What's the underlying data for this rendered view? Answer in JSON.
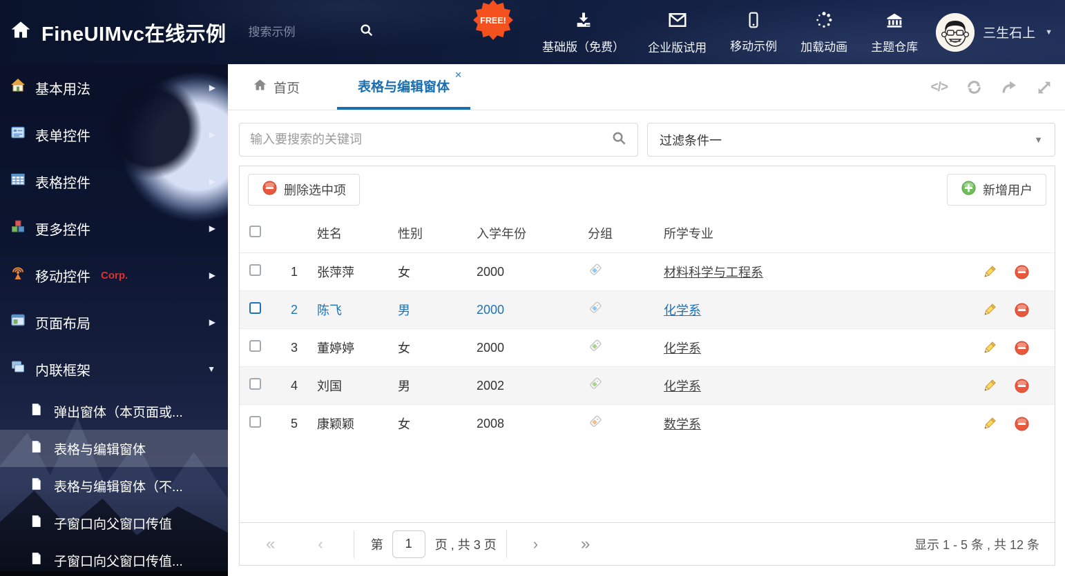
{
  "glyphs": {
    "caret_right": "▶",
    "caret_down": "▼",
    "close": "✕",
    "code": "</>",
    "first": "«",
    "prev": "‹",
    "next": "›",
    "last": "»",
    "select_caret": "▼",
    "user_caret": "▼"
  },
  "header": {
    "title": "FineUIMvc在线示例",
    "search_placeholder": "搜索示例",
    "free_badge": "FREE!",
    "nav": [
      {
        "label": "基础版（免费）"
      },
      {
        "label": "企业版试用"
      },
      {
        "label": "移动示例"
      },
      {
        "label": "加载动画"
      },
      {
        "label": "主题仓库"
      }
    ],
    "username": "三生石上"
  },
  "sidebar": {
    "items": [
      {
        "label": "基本用法"
      },
      {
        "label": "表单控件"
      },
      {
        "label": "表格控件"
      },
      {
        "label": "更多控件"
      },
      {
        "label": "移动控件",
        "badge": "Corp."
      },
      {
        "label": "页面布局"
      },
      {
        "label": "内联框架"
      }
    ],
    "subitems": [
      {
        "label": "弹出窗体（本页面或..."
      },
      {
        "label": "表格与编辑窗体"
      },
      {
        "label": "表格与编辑窗体（不..."
      },
      {
        "label": "子窗口向父窗口传值"
      },
      {
        "label": "子窗口向父窗口传值..."
      }
    ]
  },
  "tabs": {
    "home": "首页",
    "active": "表格与编辑窗体"
  },
  "filter": {
    "search_placeholder": "输入要搜索的关键词",
    "selected": "过滤条件一"
  },
  "grid": {
    "delete_button": "删除选中项",
    "add_button": "新增用户",
    "columns": [
      "姓名",
      "性别",
      "入学年份",
      "分组",
      "所学专业"
    ],
    "rows": [
      {
        "num": "1",
        "name": "张萍萍",
        "gender": "女",
        "year": "2000",
        "tag_color": "#8ec7f1",
        "major": "材料科学与工程系"
      },
      {
        "num": "2",
        "name": "陈飞",
        "gender": "男",
        "year": "2000",
        "tag_color": "#8ec7f1",
        "major": "化学系"
      },
      {
        "num": "3",
        "name": "董婷婷",
        "gender": "女",
        "year": "2000",
        "tag_color": "#a6d489",
        "major": "化学系"
      },
      {
        "num": "4",
        "name": "刘国",
        "gender": "男",
        "year": "2002",
        "tag_color": "#a6d489",
        "major": "化学系"
      },
      {
        "num": "5",
        "name": "康颖颖",
        "gender": "女",
        "year": "2008",
        "tag_color": "#f6bd8b",
        "major": "数学系"
      }
    ]
  },
  "pager": {
    "label_page": "第",
    "page": "1",
    "label_total": "页 , 共 3 页",
    "summary": "显示 1 - 5 条 , 共 12 条"
  },
  "colors": {
    "accent": "#1b6eae",
    "selected_text": "#1e72b8",
    "delete_red": "#e9573d",
    "add_green": "#62b152",
    "free_orange": "#f4511e"
  }
}
